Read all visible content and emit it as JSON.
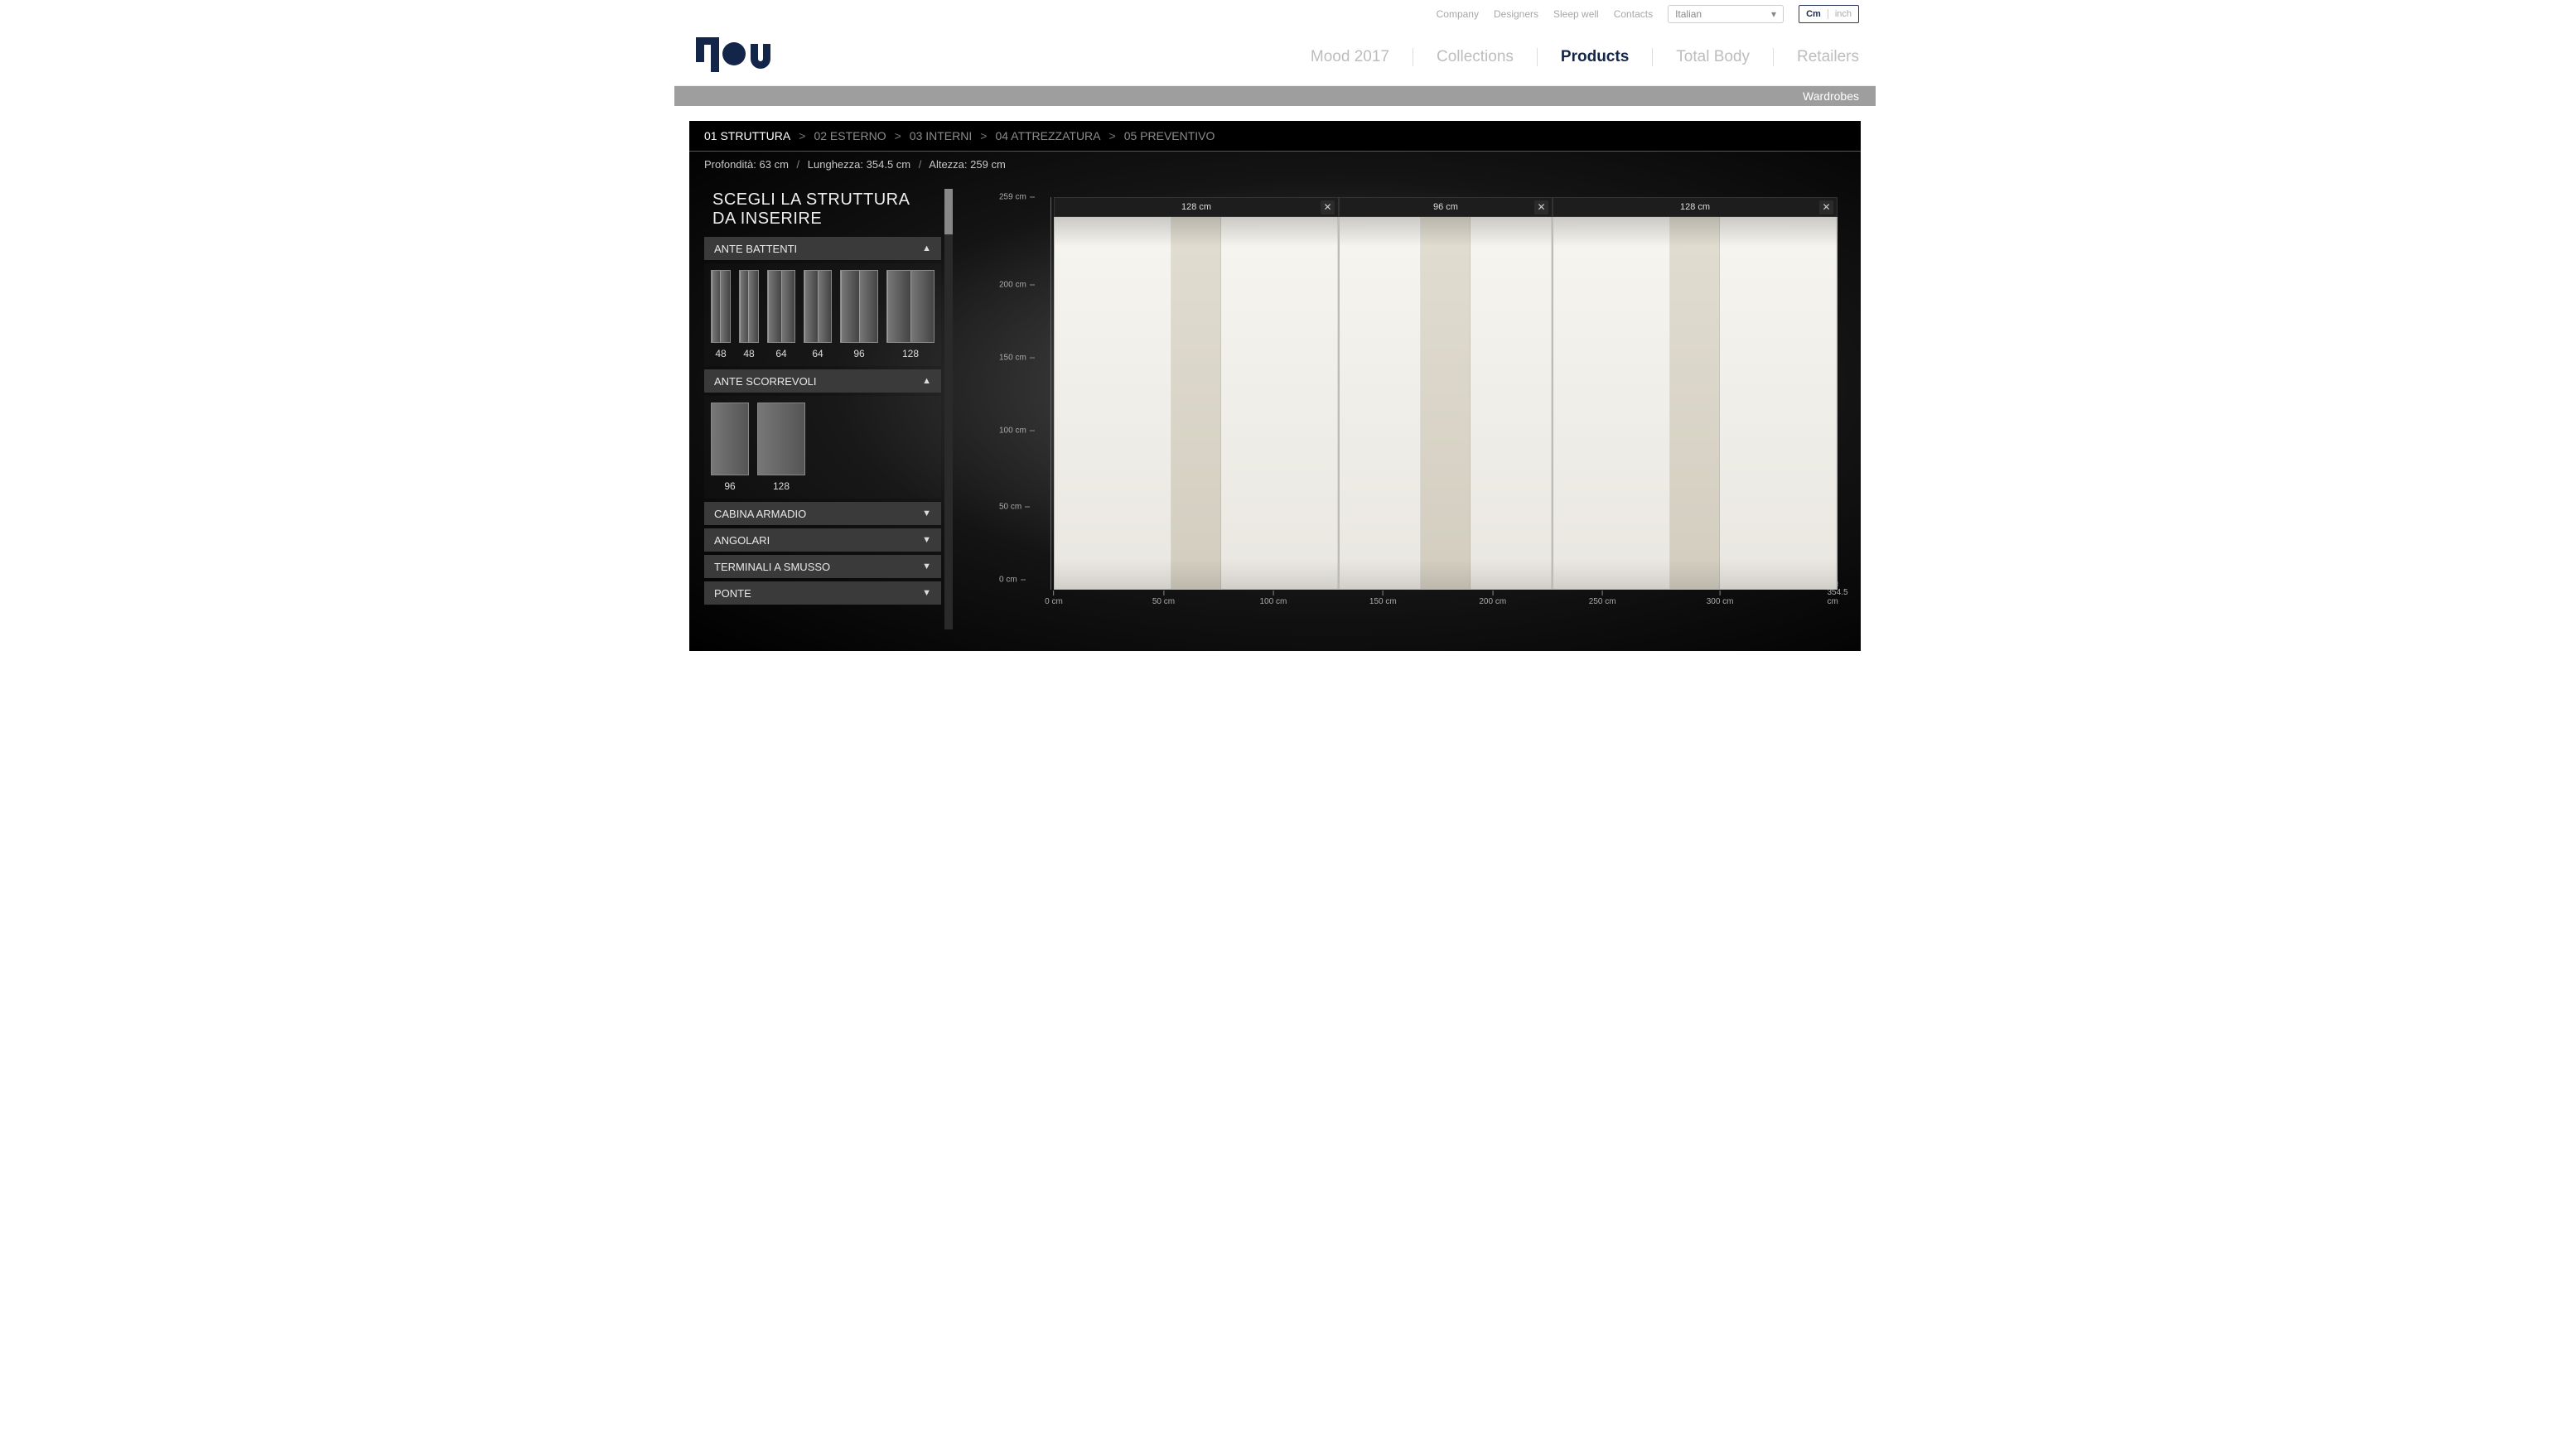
{
  "brand": "flou",
  "topbar": {
    "links": [
      "Company",
      "Designers",
      "Sleep well",
      "Contacts"
    ],
    "language": "Italian",
    "unit_cm": "Cm",
    "unit_inch": "inch"
  },
  "mainnav": {
    "items": [
      "Mood 2017",
      "Collections",
      "Products",
      "Total Body",
      "Retailers"
    ],
    "active_index": 2
  },
  "subbar": {
    "label": "Wardrobes"
  },
  "steps": {
    "items": [
      {
        "n": "01",
        "label": "STRUTTURA"
      },
      {
        "n": "02",
        "label": "ESTERNO"
      },
      {
        "n": "03",
        "label": "INTERNI"
      },
      {
        "n": "04",
        "label": "ATTREZZATURA"
      },
      {
        "n": "05",
        "label": "PREVENTIVO"
      }
    ],
    "active_index": 0
  },
  "dimensions": {
    "depth_label": "Profondità",
    "depth_value": "63 cm",
    "length_label": "Lunghezza",
    "length_value": "354.5 cm",
    "height_label": "Altezza",
    "height_value": "259 cm"
  },
  "sidebar": {
    "title": "SCEGLI LA STRUTTURA DA INSERIRE",
    "sections": {
      "battenti": {
        "label": "ANTE BATTENTI",
        "expanded": true,
        "options": [
          "48",
          "48",
          "64",
          "64",
          "96",
          "128"
        ]
      },
      "scorrevoli": {
        "label": "ANTE SCORREVOLI",
        "expanded": true,
        "options": [
          "96",
          "128"
        ]
      },
      "cabina": {
        "label": "CABINA ARMADIO",
        "expanded": false
      },
      "angolari": {
        "label": "ANGOLARI",
        "expanded": false
      },
      "terminali": {
        "label": "TERMINALI A SMUSSO",
        "expanded": false
      },
      "ponte": {
        "label": "PONTE",
        "expanded": false
      }
    }
  },
  "canvas": {
    "modules": [
      {
        "width": 128,
        "label": "128 cm"
      },
      {
        "width": 96,
        "label": "96 cm"
      },
      {
        "width": 128,
        "label": "128 cm"
      }
    ],
    "y_ticks": [
      "259 cm",
      "200 cm",
      "150 cm",
      "100 cm",
      "50 cm",
      "0 cm"
    ],
    "x_ticks": [
      "0 cm",
      "50 cm",
      "100 cm",
      "150 cm",
      "200 cm",
      "250 cm",
      "300 cm",
      "354.5 cm"
    ]
  }
}
